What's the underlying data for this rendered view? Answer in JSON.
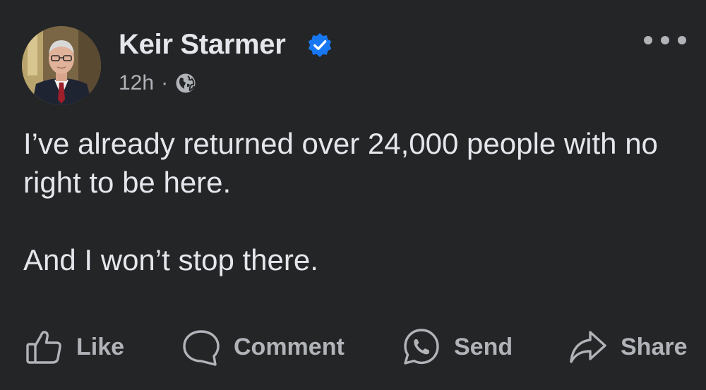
{
  "post": {
    "author": {
      "name": "Keir Starmer",
      "verified": true,
      "avatar_icon": "profile-photo"
    },
    "meta": {
      "time": "12h",
      "separator": "·",
      "audience_icon": "globe-icon"
    },
    "menu_icon": "more-horizontal-icon",
    "text": {
      "paragraph1": "I’ve already returned over 24,000 people with no right to be here.",
      "paragraph2": "And I won’t stop there."
    },
    "actions": {
      "like": "Like",
      "comment": "Comment",
      "send": "Send",
      "share": "Share"
    }
  },
  "colors": {
    "background": "#242526",
    "primary_text": "#e4e6eb",
    "secondary_text": "#b0b3b8",
    "verified_blue": "#1877f2"
  }
}
